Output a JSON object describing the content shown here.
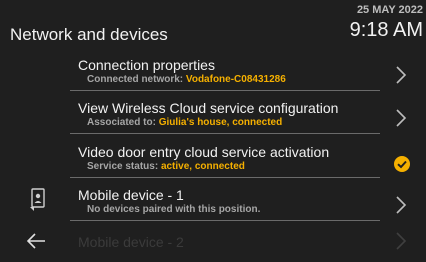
{
  "header": {
    "title": "Network and devices",
    "date": "25 MAY 2022",
    "time": "9:18 AM"
  },
  "rows": [
    {
      "title": "Connection properties",
      "sub_label": "Connected network: ",
      "sub_value": "Vodafone-C08431286",
      "icon": "chevron-right-icon"
    },
    {
      "title": "View Wireless Cloud service configuration",
      "sub_label": "Associated to: ",
      "sub_value": "Giulia's house, connected",
      "icon": "chevron-right-icon"
    },
    {
      "title": "Video door entry cloud service activation",
      "sub_label": "Service status: ",
      "sub_value": "active, connected",
      "icon": "check-circle-icon"
    },
    {
      "title": "Mobile device - 1",
      "sub_label": "No devices paired with this position.",
      "sub_value": "",
      "icon": "chevron-right-icon"
    },
    {
      "title": "Mobile device - 2",
      "icon": "chevron-right-icon"
    }
  ],
  "colors": {
    "accent": "#f5b000",
    "background": "#1f1f1f",
    "text": "#f2f2f2",
    "subtext": "#a6a6a6"
  }
}
